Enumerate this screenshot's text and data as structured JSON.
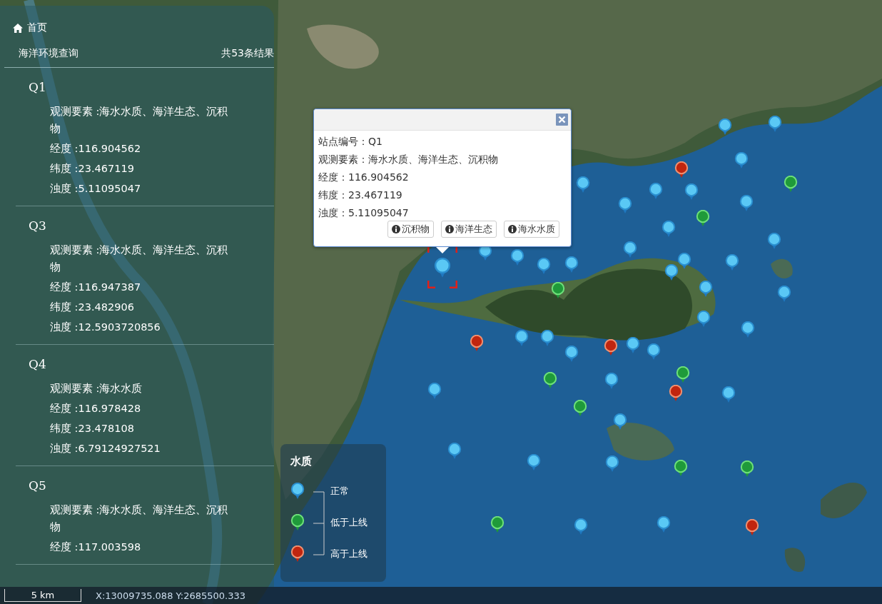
{
  "breadcrumb": {
    "label": "首页"
  },
  "panel": {
    "title": "海洋环境查询",
    "count": "共53条结果",
    "stations": [
      {
        "name": "Q1",
        "fields": [
          "观测要素 :海水水质、海洋生态、沉积物",
          "经度 :116.904562",
          "纬度 :23.467119",
          "浊度 :5.11095047"
        ]
      },
      {
        "name": "Q3",
        "fields": [
          "观测要素 :海水水质、海洋生态、沉积物",
          "经度 :116.947387",
          "纬度 :23.482906",
          "浊度 :12.5903720856"
        ]
      },
      {
        "name": "Q4",
        "fields": [
          "观测要素 :海水水质",
          "经度 :116.978428",
          "纬度 :23.478108",
          "浊度 :6.79124927521"
        ]
      },
      {
        "name": "Q5",
        "fields": [
          "观测要素 :海水水质、海洋生态、沉积物",
          "经度 :117.003598"
        ]
      }
    ]
  },
  "markers": [
    {
      "kind": "normal",
      "selected": false
    },
    {
      "kind": "normal",
      "selected": false
    },
    {
      "kind": "normal",
      "selected": false
    },
    {
      "kind": "normal",
      "selected": false
    },
    {
      "kind": "normal",
      "selected": false
    },
    {
      "kind": "normal",
      "selected": false
    },
    {
      "kind": "normal",
      "selected": false
    },
    {
      "kind": "normal",
      "selected": false
    },
    {
      "kind": "normal",
      "selected": false
    },
    {
      "kind": "normal",
      "selected": false
    },
    {
      "kind": "normal",
      "selected": false
    },
    {
      "kind": "normal",
      "selected": false
    },
    {
      "kind": "normal",
      "selected": false
    },
    {
      "kind": "normal",
      "selected": false
    },
    {
      "kind": "normal",
      "selected": false
    },
    {
      "kind": "normal",
      "selected": false
    },
    {
      "kind": "normal",
      "selected": false
    },
    {
      "kind": "normal",
      "selected": false
    },
    {
      "kind": "normal",
      "selected": true
    },
    {
      "kind": "normal",
      "selected": false
    },
    {
      "kind": "normal",
      "selected": false
    },
    {
      "kind": "normal",
      "selected": false
    },
    {
      "kind": "normal",
      "selected": false
    },
    {
      "kind": "normal",
      "selected": false
    },
    {
      "kind": "normal",
      "selected": false
    },
    {
      "kind": "normal",
      "selected": false
    },
    {
      "kind": "normal",
      "selected": false
    },
    {
      "kind": "normal",
      "selected": false
    },
    {
      "kind": "normal",
      "selected": false
    },
    {
      "kind": "normal",
      "selected": false
    },
    {
      "kind": "normal",
      "selected": false
    },
    {
      "kind": "normal",
      "selected": false
    },
    {
      "kind": "normal",
      "selected": false
    },
    {
      "kind": "normal",
      "selected": false
    },
    {
      "kind": "normal",
      "selected": false
    },
    {
      "kind": "normal",
      "selected": false
    },
    {
      "kind": "normal",
      "selected": false
    },
    {
      "kind": "low",
      "selected": false
    },
    {
      "kind": "low",
      "selected": false
    },
    {
      "kind": "low",
      "selected": false
    },
    {
      "kind": "low",
      "selected": false
    },
    {
      "kind": "low",
      "selected": false
    },
    {
      "kind": "low",
      "selected": false
    },
    {
      "kind": "low",
      "selected": false
    },
    {
      "kind": "low",
      "selected": false
    },
    {
      "kind": "low",
      "selected": false
    },
    {
      "kind": "high",
      "selected": false
    },
    {
      "kind": "high",
      "selected": false
    },
    {
      "kind": "high",
      "selected": false
    },
    {
      "kind": "high",
      "selected": false
    },
    {
      "kind": "high",
      "selected": false
    }
  ],
  "popup": {
    "lines": [
      "站点编号：Q1",
      "观测要素：海水水质、海洋生态、沉积物",
      "经度：116.904562",
      "纬度：23.467119",
      "浊度：5.11095047"
    ],
    "buttons": [
      "沉积物",
      "海洋生态",
      "海水水质"
    ]
  },
  "legend": {
    "title": "水质",
    "items": [
      {
        "kind": "normal",
        "label": "正常"
      },
      {
        "kind": "low",
        "label": "低于上线"
      },
      {
        "kind": "high",
        "label": "高于上线"
      }
    ]
  },
  "status_bar": {
    "scale": "5 km",
    "coordinates": "X:13009735.088 Y:2685500.333"
  }
}
